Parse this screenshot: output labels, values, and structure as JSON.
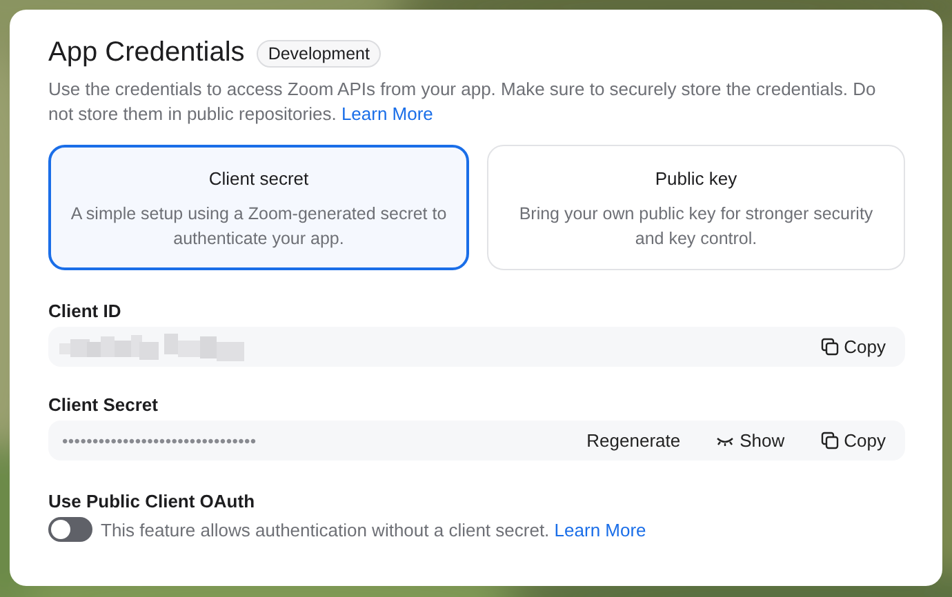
{
  "title": "App Credentials",
  "badge": "Development",
  "description": "Use the credentials to access Zoom APIs from your app. Make sure to securely store the credentials. Do not store them in public repositories.",
  "description_link": "Learn More",
  "options": [
    {
      "title": "Client secret",
      "description": "A simple setup using a Zoom-generated secret to authenticate your app.",
      "selected": true
    },
    {
      "title": "Public key",
      "description": "Bring your own public key for stronger security and key control.",
      "selected": false
    }
  ],
  "fields": [
    {
      "label": "Client ID",
      "kind": "redacted",
      "actions": [
        {
          "label": "Copy",
          "kind": "copy"
        }
      ]
    },
    {
      "label": "Client Secret",
      "kind": "masked",
      "value": "••••••••••••••••••••••••••••••••",
      "actions": [
        {
          "label": "Regenerate",
          "kind": "plain"
        },
        {
          "label": "Show",
          "kind": "reveal"
        },
        {
          "label": "Copy",
          "kind": "copy"
        }
      ]
    }
  ],
  "public_oauth": {
    "label": "Use Public Client OAuth",
    "on": false,
    "description": "This feature allows authentication without a client secret.",
    "link": "Learn More"
  }
}
